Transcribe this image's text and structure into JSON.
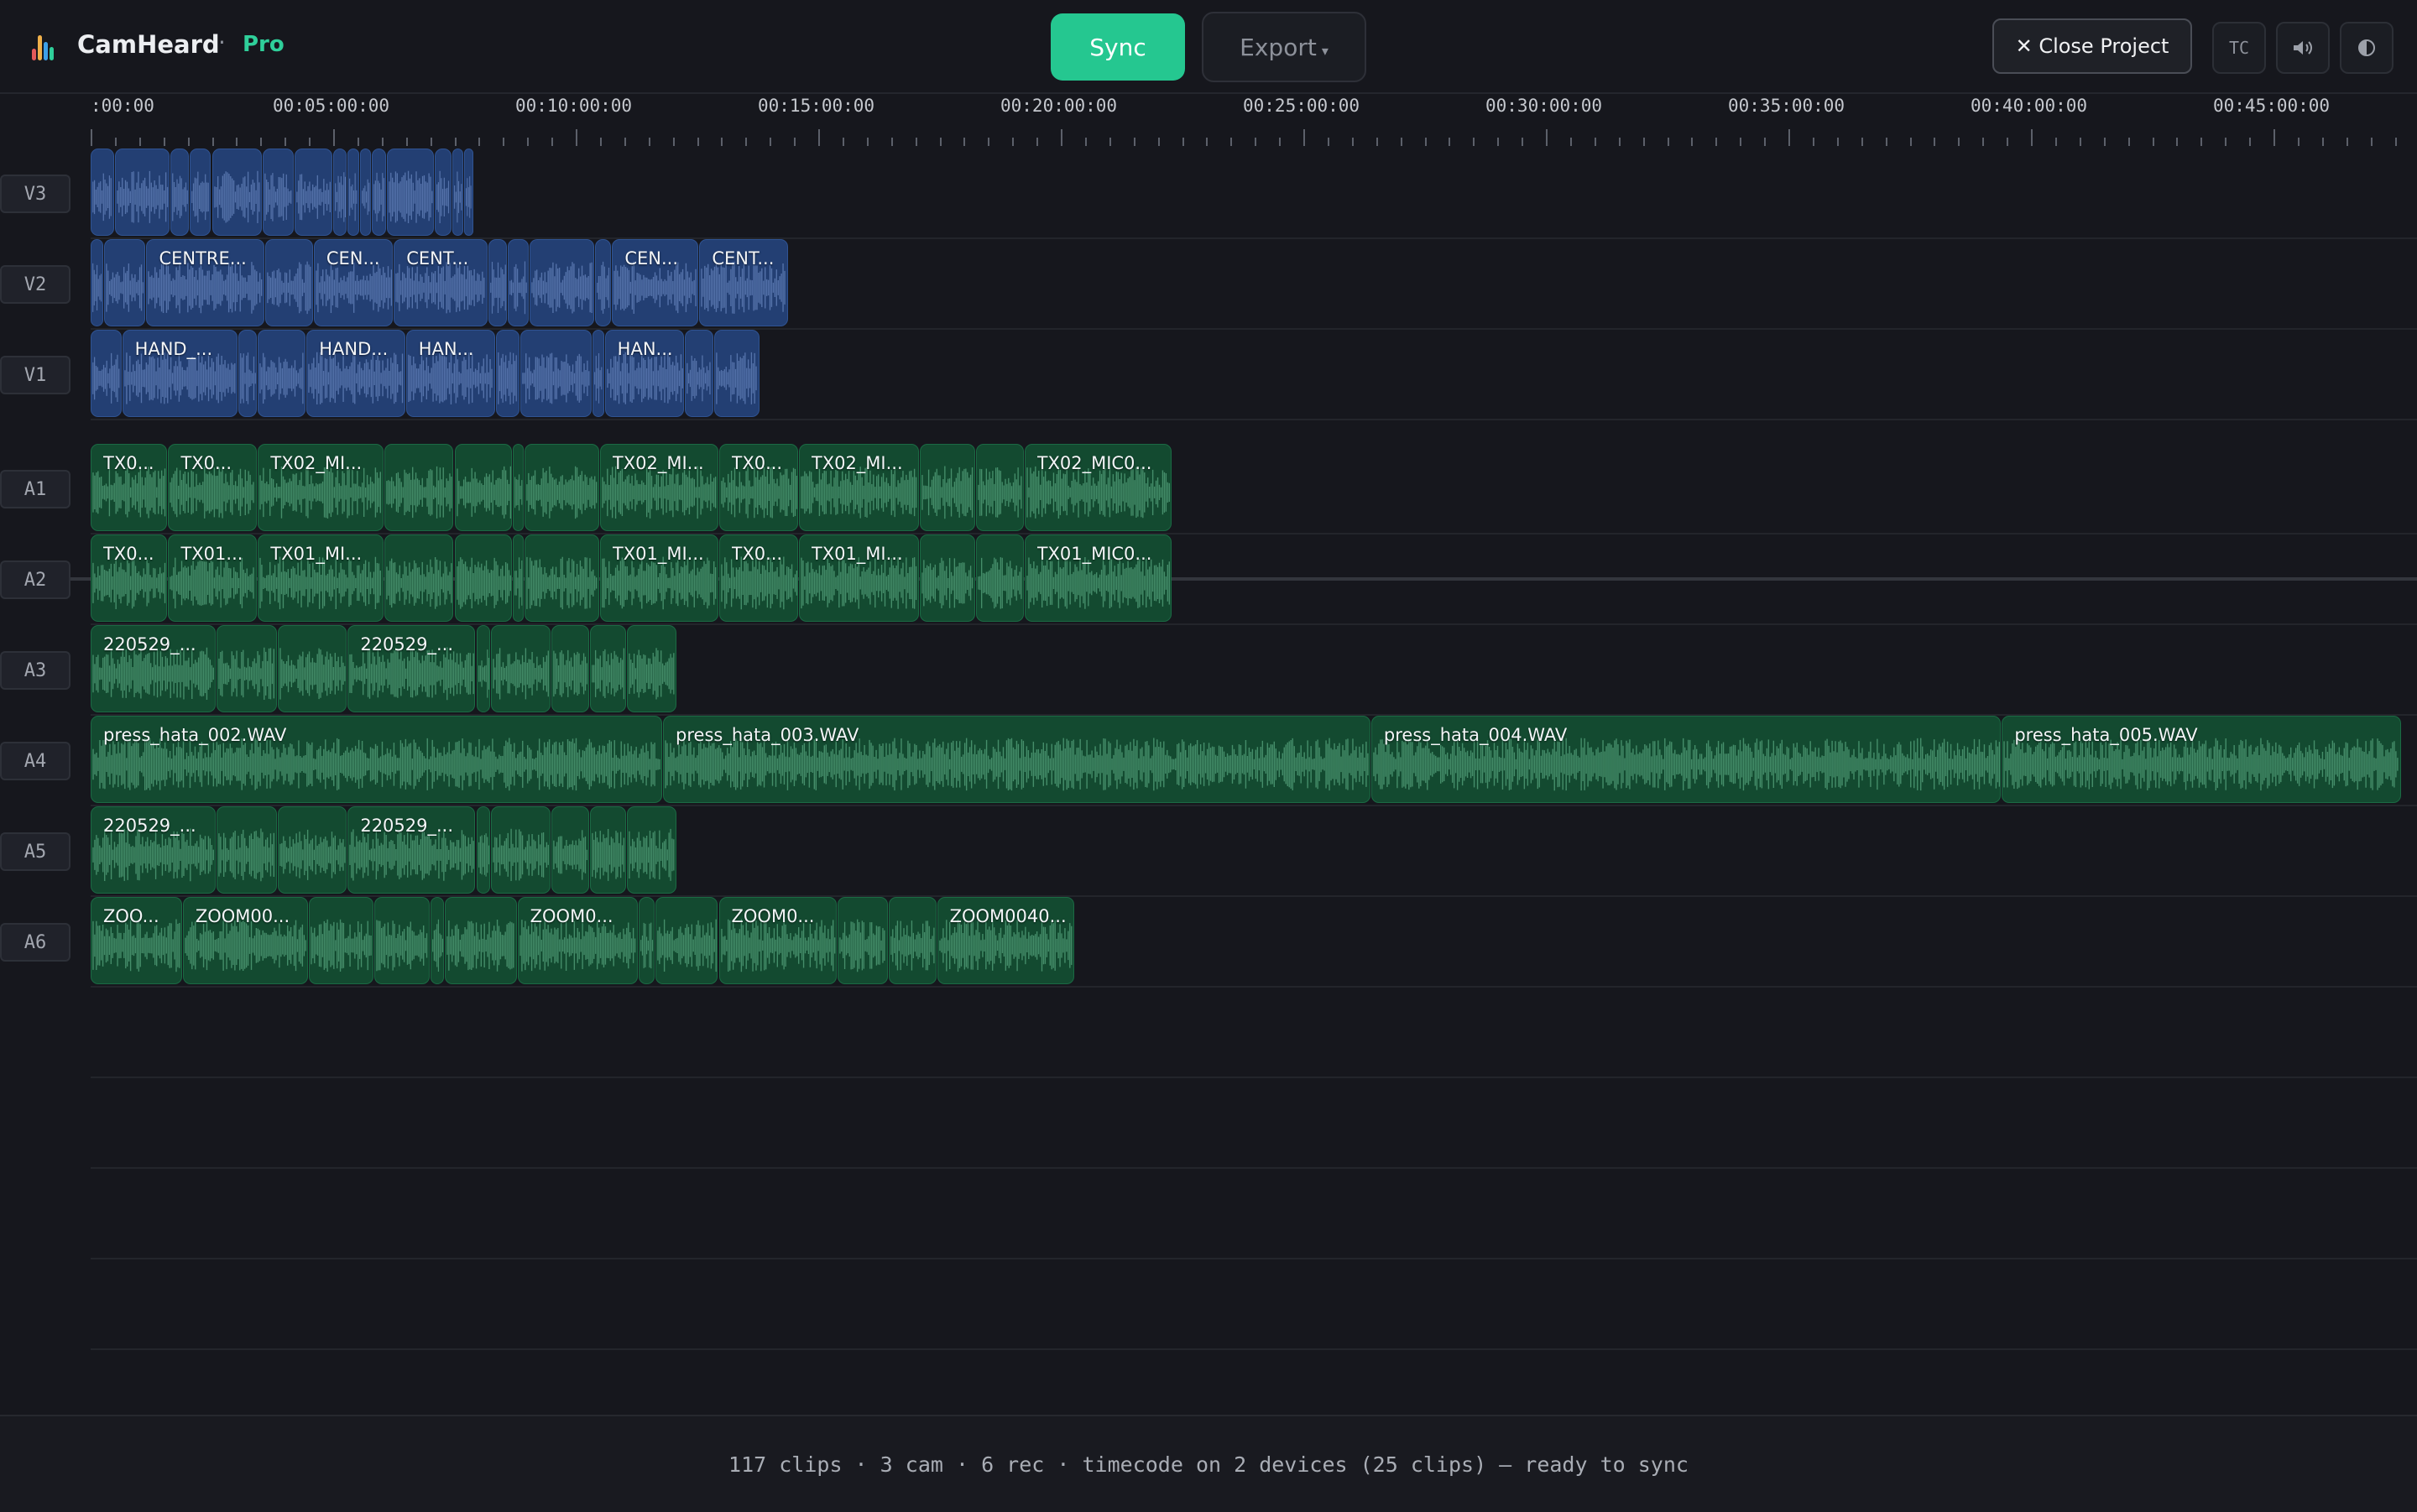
{
  "header": {
    "app_name": "CamHeard",
    "separator": "·",
    "tier": "Pro",
    "sync_label": "Sync",
    "export_label": "Export",
    "close_label": "Close Project",
    "tc_label": "TC",
    "icons": [
      "app-logo-icon",
      "close-icon",
      "speaker-icon",
      "contrast-icon"
    ]
  },
  "ruler": {
    "labels": [
      ":00:00",
      "00:05:00:00",
      "00:10:00:00",
      "00:15:00:00",
      "00:20:00:00",
      "00:25:00:00",
      "00:30:00:00",
      "00:35:00:00",
      "00:40:00:00",
      "00:45:00:00"
    ]
  },
  "tracks": [
    {
      "id": "V3",
      "kind": "video",
      "clips": [
        {
          "s": 0,
          "e": 0.5,
          "n": ""
        },
        {
          "s": 0.5,
          "e": 1.65,
          "n": ""
        },
        {
          "s": 1.65,
          "e": 2.05,
          "n": ""
        },
        {
          "s": 2.05,
          "e": 2.5,
          "n": ""
        },
        {
          "s": 2.5,
          "e": 3.55,
          "n": ""
        },
        {
          "s": 3.55,
          "e": 4.2,
          "n": ""
        },
        {
          "s": 4.2,
          "e": 5.0,
          "n": ""
        },
        {
          "s": 5.0,
          "e": 5.3,
          "n": ""
        },
        {
          "s": 5.3,
          "e": 5.55,
          "n": ""
        },
        {
          "s": 5.55,
          "e": 5.8,
          "n": ""
        },
        {
          "s": 5.8,
          "e": 6.1,
          "n": ""
        },
        {
          "s": 6.1,
          "e": 7.1,
          "n": ""
        },
        {
          "s": 7.1,
          "e": 7.45,
          "n": ""
        },
        {
          "s": 7.45,
          "e": 7.7,
          "n": ""
        },
        {
          "s": 7.7,
          "e": 7.9,
          "n": ""
        }
      ]
    },
    {
      "id": "V2",
      "kind": "video",
      "clips": [
        {
          "s": 0,
          "e": 0.28,
          "n": ""
        },
        {
          "s": 0.28,
          "e": 1.15,
          "n": ""
        },
        {
          "s": 1.15,
          "e": 3.6,
          "n": "CENTRE..."
        },
        {
          "s": 3.6,
          "e": 4.6,
          "n": ""
        },
        {
          "s": 4.6,
          "e": 6.25,
          "n": "CEN..."
        },
        {
          "s": 6.25,
          "e": 8.2,
          "n": "CENT..."
        },
        {
          "s": 8.2,
          "e": 8.6,
          "n": ""
        },
        {
          "s": 8.6,
          "e": 9.05,
          "n": ""
        },
        {
          "s": 9.05,
          "e": 10.4,
          "n": ""
        },
        {
          "s": 10.4,
          "e": 10.75,
          "n": ""
        },
        {
          "s": 10.75,
          "e": 12.55,
          "n": "CEN..."
        },
        {
          "s": 12.55,
          "e": 14.4,
          "n": "CENT..."
        }
      ]
    },
    {
      "id": "V1",
      "kind": "video",
      "clips": [
        {
          "s": 0,
          "e": 0.65,
          "n": ""
        },
        {
          "s": 0.65,
          "e": 3.05,
          "n": "HAND_..."
        },
        {
          "s": 3.05,
          "e": 3.45,
          "n": ""
        },
        {
          "s": 3.45,
          "e": 4.45,
          "n": ""
        },
        {
          "s": 4.45,
          "e": 6.5,
          "n": "HAND..."
        },
        {
          "s": 6.5,
          "e": 8.35,
          "n": "HAN..."
        },
        {
          "s": 8.35,
          "e": 8.85,
          "n": ""
        },
        {
          "s": 8.85,
          "e": 10.35,
          "n": ""
        },
        {
          "s": 10.35,
          "e": 10.6,
          "n": ""
        },
        {
          "s": 10.6,
          "e": 12.25,
          "n": "HAN..."
        },
        {
          "s": 12.25,
          "e": 12.85,
          "n": ""
        },
        {
          "s": 12.85,
          "e": 13.8,
          "n": ""
        }
      ]
    },
    {
      "id": "A1",
      "kind": "audio",
      "clips": [
        {
          "s": 0,
          "e": 1.6,
          "n": "TX0..."
        },
        {
          "s": 1.6,
          "e": 3.45,
          "n": "TX0..."
        },
        {
          "s": 3.45,
          "e": 6.05,
          "n": "TX02_MI..."
        },
        {
          "s": 6.05,
          "e": 7.5,
          "n": ""
        },
        {
          "s": 7.5,
          "e": 8.7,
          "n": ""
        },
        {
          "s": 8.7,
          "e": 8.95,
          "n": ""
        },
        {
          "s": 8.95,
          "e": 10.5,
          "n": ""
        },
        {
          "s": 10.5,
          "e": 12.95,
          "n": "TX02_MI..."
        },
        {
          "s": 12.95,
          "e": 14.6,
          "n": "TX0..."
        },
        {
          "s": 14.6,
          "e": 17.1,
          "n": "TX02_MI..."
        },
        {
          "s": 17.1,
          "e": 18.25,
          "n": ""
        },
        {
          "s": 18.25,
          "e": 19.25,
          "n": ""
        },
        {
          "s": 19.25,
          "e": 22.3,
          "n": "TX02_MIC0..."
        }
      ]
    },
    {
      "id": "A2",
      "kind": "audio",
      "clips": [
        {
          "s": 0,
          "e": 1.6,
          "n": "TX0..."
        },
        {
          "s": 1.6,
          "e": 3.45,
          "n": "TX01..."
        },
        {
          "s": 3.45,
          "e": 6.05,
          "n": "TX01_MI..."
        },
        {
          "s": 6.05,
          "e": 7.5,
          "n": ""
        },
        {
          "s": 7.5,
          "e": 8.7,
          "n": ""
        },
        {
          "s": 8.7,
          "e": 8.95,
          "n": ""
        },
        {
          "s": 8.95,
          "e": 10.5,
          "n": ""
        },
        {
          "s": 10.5,
          "e": 12.95,
          "n": "TX01_MI..."
        },
        {
          "s": 12.95,
          "e": 14.6,
          "n": "TX0..."
        },
        {
          "s": 14.6,
          "e": 17.1,
          "n": "TX01_MI..."
        },
        {
          "s": 17.1,
          "e": 18.25,
          "n": ""
        },
        {
          "s": 18.25,
          "e": 19.25,
          "n": ""
        },
        {
          "s": 19.25,
          "e": 22.3,
          "n": "TX01_MIC0..."
        }
      ]
    },
    {
      "id": "A3",
      "kind": "audio",
      "clips": [
        {
          "s": 0,
          "e": 2.6,
          "n": "220529_..."
        },
        {
          "s": 2.6,
          "e": 3.85,
          "n": ""
        },
        {
          "s": 3.85,
          "e": 5.3,
          "n": ""
        },
        {
          "s": 5.3,
          "e": 7.95,
          "n": "220529_..."
        },
        {
          "s": 7.95,
          "e": 8.25,
          "n": ""
        },
        {
          "s": 8.25,
          "e": 9.5,
          "n": ""
        },
        {
          "s": 9.5,
          "e": 10.3,
          "n": ""
        },
        {
          "s": 10.3,
          "e": 11.05,
          "n": ""
        },
        {
          "s": 11.05,
          "e": 12.1,
          "n": ""
        }
      ]
    },
    {
      "id": "A4",
      "kind": "audio",
      "clips": [
        {
          "s": 0,
          "e": 11.8,
          "n": "press_hata_002.WAV"
        },
        {
          "s": 11.8,
          "e": 26.4,
          "n": "press_hata_003.WAV"
        },
        {
          "s": 26.4,
          "e": 39.4,
          "n": "press_hata_004.WAV"
        },
        {
          "s": 39.4,
          "e": 47.65,
          "n": "press_hata_005.WAV"
        }
      ]
    },
    {
      "id": "A5",
      "kind": "audio",
      "clips": [
        {
          "s": 0,
          "e": 2.6,
          "n": "220529_..."
        },
        {
          "s": 2.6,
          "e": 3.85,
          "n": ""
        },
        {
          "s": 3.85,
          "e": 5.3,
          "n": ""
        },
        {
          "s": 5.3,
          "e": 7.95,
          "n": "220529_..."
        },
        {
          "s": 7.95,
          "e": 8.25,
          "n": ""
        },
        {
          "s": 8.25,
          "e": 9.5,
          "n": ""
        },
        {
          "s": 9.5,
          "e": 10.3,
          "n": ""
        },
        {
          "s": 10.3,
          "e": 11.05,
          "n": ""
        },
        {
          "s": 11.05,
          "e": 12.1,
          "n": ""
        }
      ]
    },
    {
      "id": "A6",
      "kind": "audio",
      "clips": [
        {
          "s": 0,
          "e": 1.9,
          "n": "ZOO..."
        },
        {
          "s": 1.9,
          "e": 4.5,
          "n": "ZOOM00..."
        },
        {
          "s": 4.5,
          "e": 5.85,
          "n": ""
        },
        {
          "s": 5.85,
          "e": 7.0,
          "n": ""
        },
        {
          "s": 7.0,
          "e": 7.3,
          "n": ""
        },
        {
          "s": 7.3,
          "e": 8.8,
          "n": ""
        },
        {
          "s": 8.8,
          "e": 11.3,
          "n": "ZOOM0..."
        },
        {
          "s": 11.3,
          "e": 11.65,
          "n": ""
        },
        {
          "s": 11.65,
          "e": 12.95,
          "n": ""
        },
        {
          "s": 12.95,
          "e": 15.4,
          "n": "ZOOM0..."
        },
        {
          "s": 15.4,
          "e": 16.45,
          "n": ""
        },
        {
          "s": 16.45,
          "e": 17.45,
          "n": ""
        },
        {
          "s": 17.45,
          "e": 20.3,
          "n": "ZOOM0040..."
        }
      ]
    }
  ],
  "status": {
    "text": "117 clips · 3 cam · 6 rec · timecode on 2 devices (25 clips) — ready to sync"
  },
  "colors": {
    "accent": "#25c790",
    "video_clip": "#233f73",
    "audio_clip": "#134a30",
    "background": "#16171d"
  }
}
